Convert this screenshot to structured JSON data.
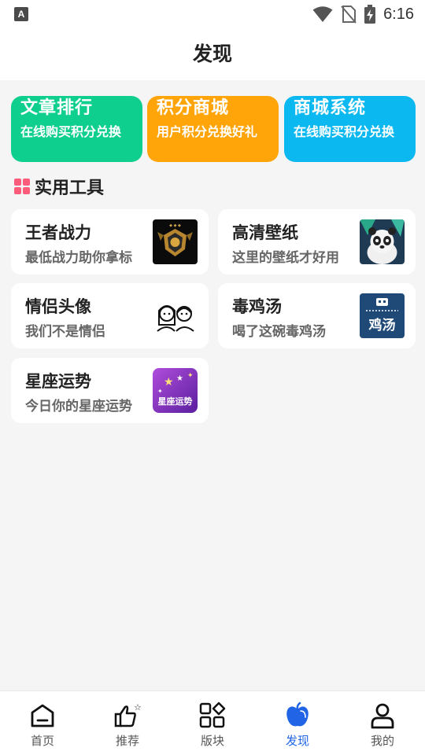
{
  "status_bar": {
    "time": "6:16",
    "app_icon": "A"
  },
  "header": {
    "title": "发现"
  },
  "feature_cards": [
    {
      "title": "文章排行",
      "subtitle": "在线购买积分兑换",
      "color": "#0fcf8e"
    },
    {
      "title": "积分商城",
      "subtitle": "用户积分兑换好礼",
      "color": "#ffa50a"
    },
    {
      "title": "商城系统",
      "subtitle": "在线购买积分兑换",
      "color": "#0bb8f0"
    }
  ],
  "tools_section": {
    "title": "实用工具",
    "accent_color": "#ff5c7c"
  },
  "tools": [
    {
      "title": "王者战力",
      "subtitle": "最低战力助你拿标",
      "thumb_text": ""
    },
    {
      "title": "高清壁纸",
      "subtitle": "这里的壁纸才好用",
      "thumb_text": ""
    },
    {
      "title": "情侣头像",
      "subtitle": "我们不是情侣",
      "thumb_text": ""
    },
    {
      "title": "毒鸡汤",
      "subtitle": "喝了这碗毒鸡汤",
      "thumb_text": "鸡汤"
    },
    {
      "title": "星座运势",
      "subtitle": "今日你的星座运势",
      "thumb_text": "星座运势"
    }
  ],
  "tabbar": {
    "active_color": "#2165e6",
    "items": [
      {
        "label": "首页",
        "icon": "home-icon"
      },
      {
        "label": "推荐",
        "icon": "thumbs-up-icon"
      },
      {
        "label": "版块",
        "icon": "category-grid-icon"
      },
      {
        "label": "发现",
        "icon": "discover-icon",
        "active": true
      },
      {
        "label": "我的",
        "icon": "user-icon"
      }
    ]
  }
}
